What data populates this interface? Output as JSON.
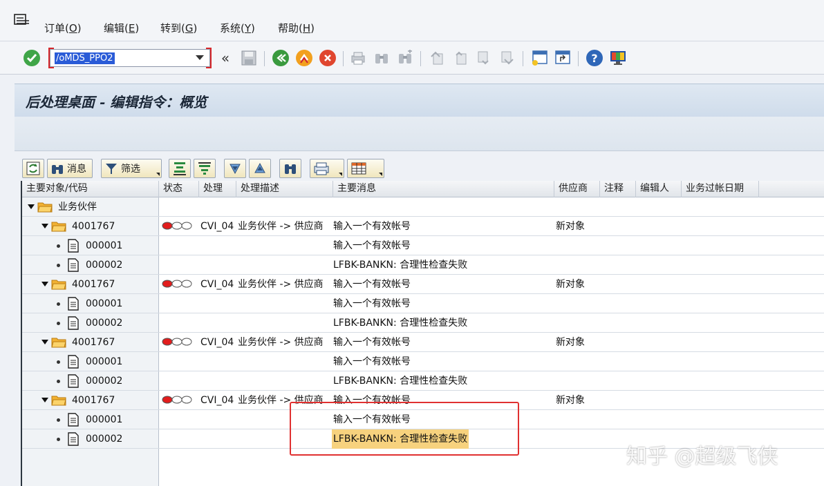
{
  "menu": {
    "items": [
      {
        "label": "订单",
        "key": "O"
      },
      {
        "label": "编辑",
        "key": "E"
      },
      {
        "label": "转到",
        "key": "G"
      },
      {
        "label": "系统",
        "key": "Y"
      },
      {
        "label": "帮助",
        "key": "H"
      }
    ]
  },
  "toolbar": {
    "command_value": "/oMDS_PPO2",
    "expand_glyph": "«"
  },
  "page": {
    "title": "后处理桌面 - 编辑指令：概览"
  },
  "alv_toolbar": {
    "messages_label": "消息",
    "filter_label": "筛选"
  },
  "grid": {
    "columns": {
      "main_object": "主要对象/代码",
      "status": "状态",
      "process": "处理",
      "process_desc": "处理描述",
      "main_message": "主要消息",
      "vendor": "供应商",
      "note": "注释",
      "editor": "编辑人",
      "post_date": "业务过帐日期"
    },
    "root_label": "业务伙伴",
    "groups": [
      {
        "id": "4001767",
        "process": "CVI_04",
        "process_desc": "业务伙伴 -> 供应商",
        "message": "输入一个有效帐号",
        "vendor": "新对象",
        "children": [
          {
            "code": "000001",
            "message": "输入一个有效帐号"
          },
          {
            "code": "000002",
            "message": "LFBK-BANKN: 合理性检查失败"
          }
        ]
      },
      {
        "id": "4001767",
        "process": "CVI_04",
        "process_desc": "业务伙伴 -> 供应商",
        "message": "输入一个有效帐号",
        "vendor": "新对象",
        "children": [
          {
            "code": "000001",
            "message": "输入一个有效帐号"
          },
          {
            "code": "000002",
            "message": "LFBK-BANKN: 合理性检查失败"
          }
        ]
      },
      {
        "id": "4001767",
        "process": "CVI_04",
        "process_desc": "业务伙伴 -> 供应商",
        "message": "输入一个有效帐号",
        "vendor": "新对象",
        "children": [
          {
            "code": "000001",
            "message": "输入一个有效帐号"
          },
          {
            "code": "000002",
            "message": "LFBK-BANKN: 合理性检查失败"
          }
        ]
      },
      {
        "id": "4001767",
        "process": "CVI_04",
        "process_desc": "业务伙伴 -> 供应商",
        "message": "输入一个有效帐号",
        "vendor": "新对象",
        "children": [
          {
            "code": "000001",
            "message": "输入一个有效帐号"
          },
          {
            "code": "000002",
            "message": "LFBK-BANKN: 合理性检查失败"
          }
        ]
      }
    ]
  },
  "watermark": "知乎 @超级飞侠",
  "colors": {
    "accent_blue": "#2a5bd7",
    "error_red": "#e03030",
    "highlight": "#f7d27e",
    "folder": "#f2b233"
  }
}
